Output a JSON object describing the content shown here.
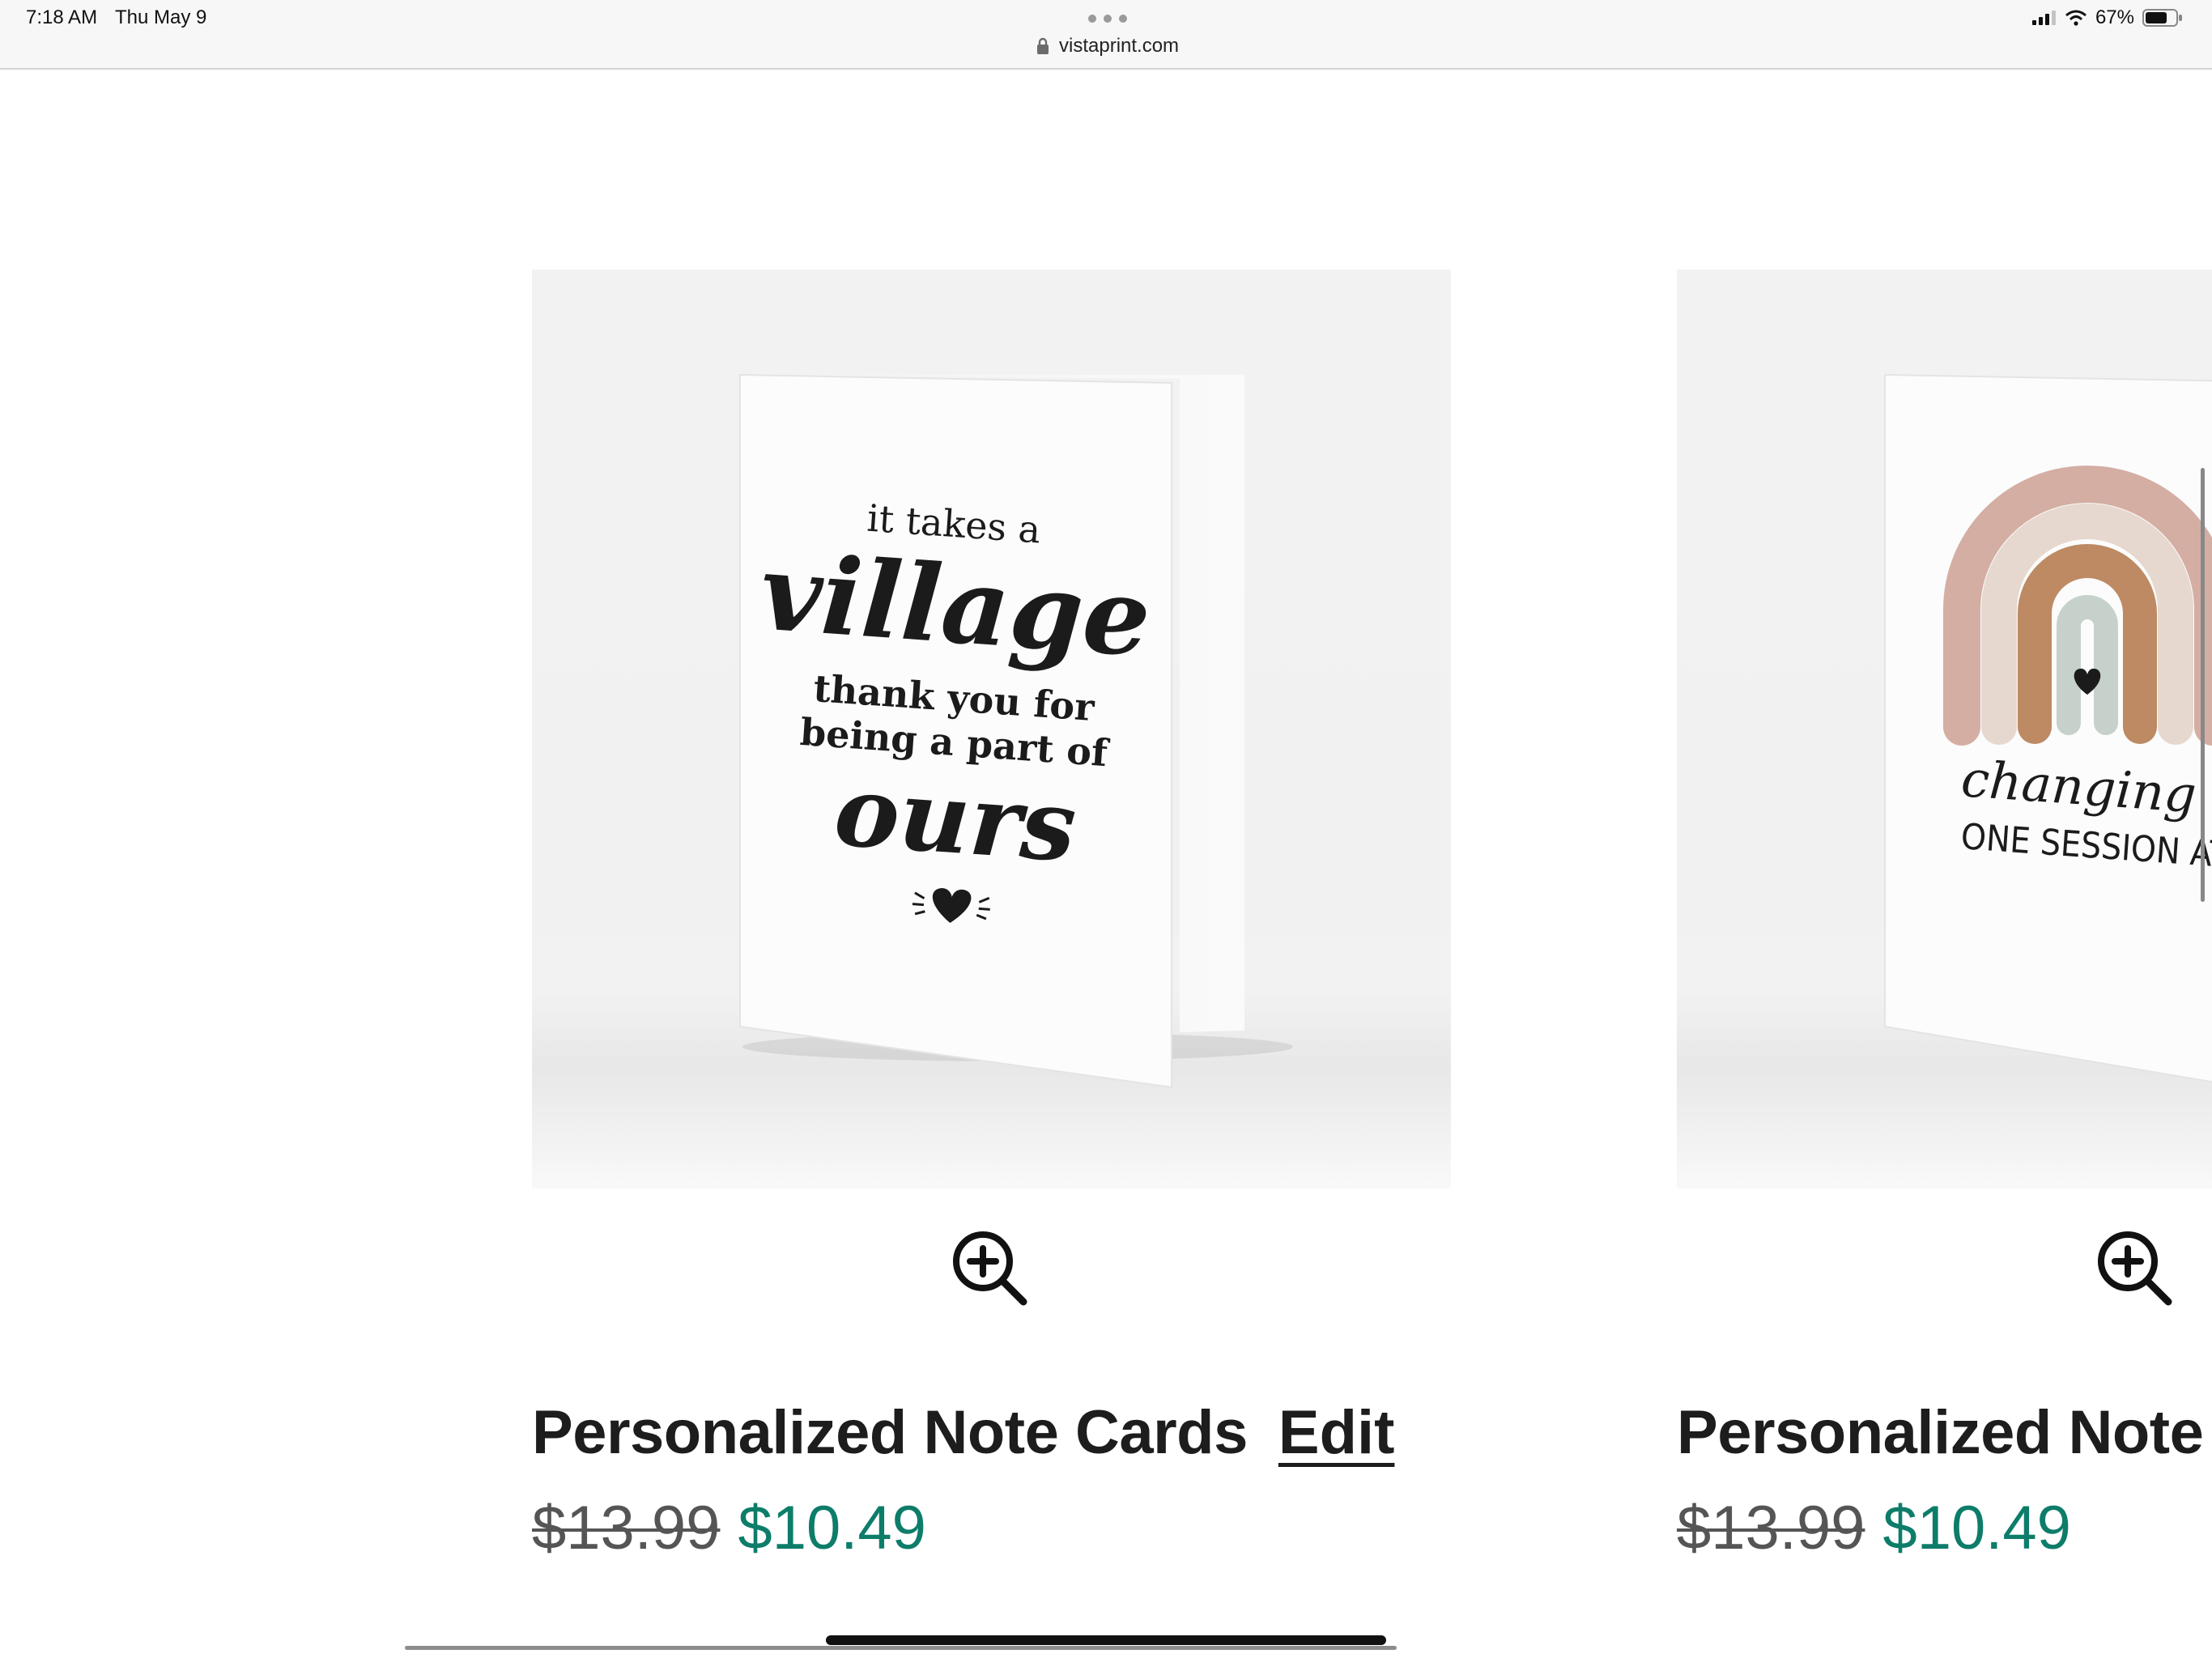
{
  "status_bar": {
    "time": "7:18 AM",
    "date": "Thu May 9",
    "battery": "67%",
    "icons": [
      "signal-icon",
      "wifi-icon",
      "battery-icon"
    ]
  },
  "browser": {
    "url": "vistaprint.com",
    "lock_icon": "lock-icon"
  },
  "products": [
    {
      "title": "Personalized Note Cards",
      "edit_label": "Edit",
      "price_original": "$13.99",
      "price_sale": "$10.49",
      "card_art": {
        "line1": "it takes a",
        "line2": "village",
        "line3": "thank you for",
        "line4": "being a part of",
        "line5": "ours"
      }
    },
    {
      "title": "Personalized Note",
      "price_original": "$13.99",
      "price_sale": "$10.49",
      "card_art": {
        "line1": "changing live",
        "line2": "ONE SESSION AT A TIM"
      }
    }
  ],
  "colors": {
    "sale_price": "#0d7d6a",
    "original_price": "#555555",
    "rainbow": [
      "#d4aea3",
      "#e6d8ce",
      "#bd8a63",
      "#c7d1cb"
    ]
  }
}
